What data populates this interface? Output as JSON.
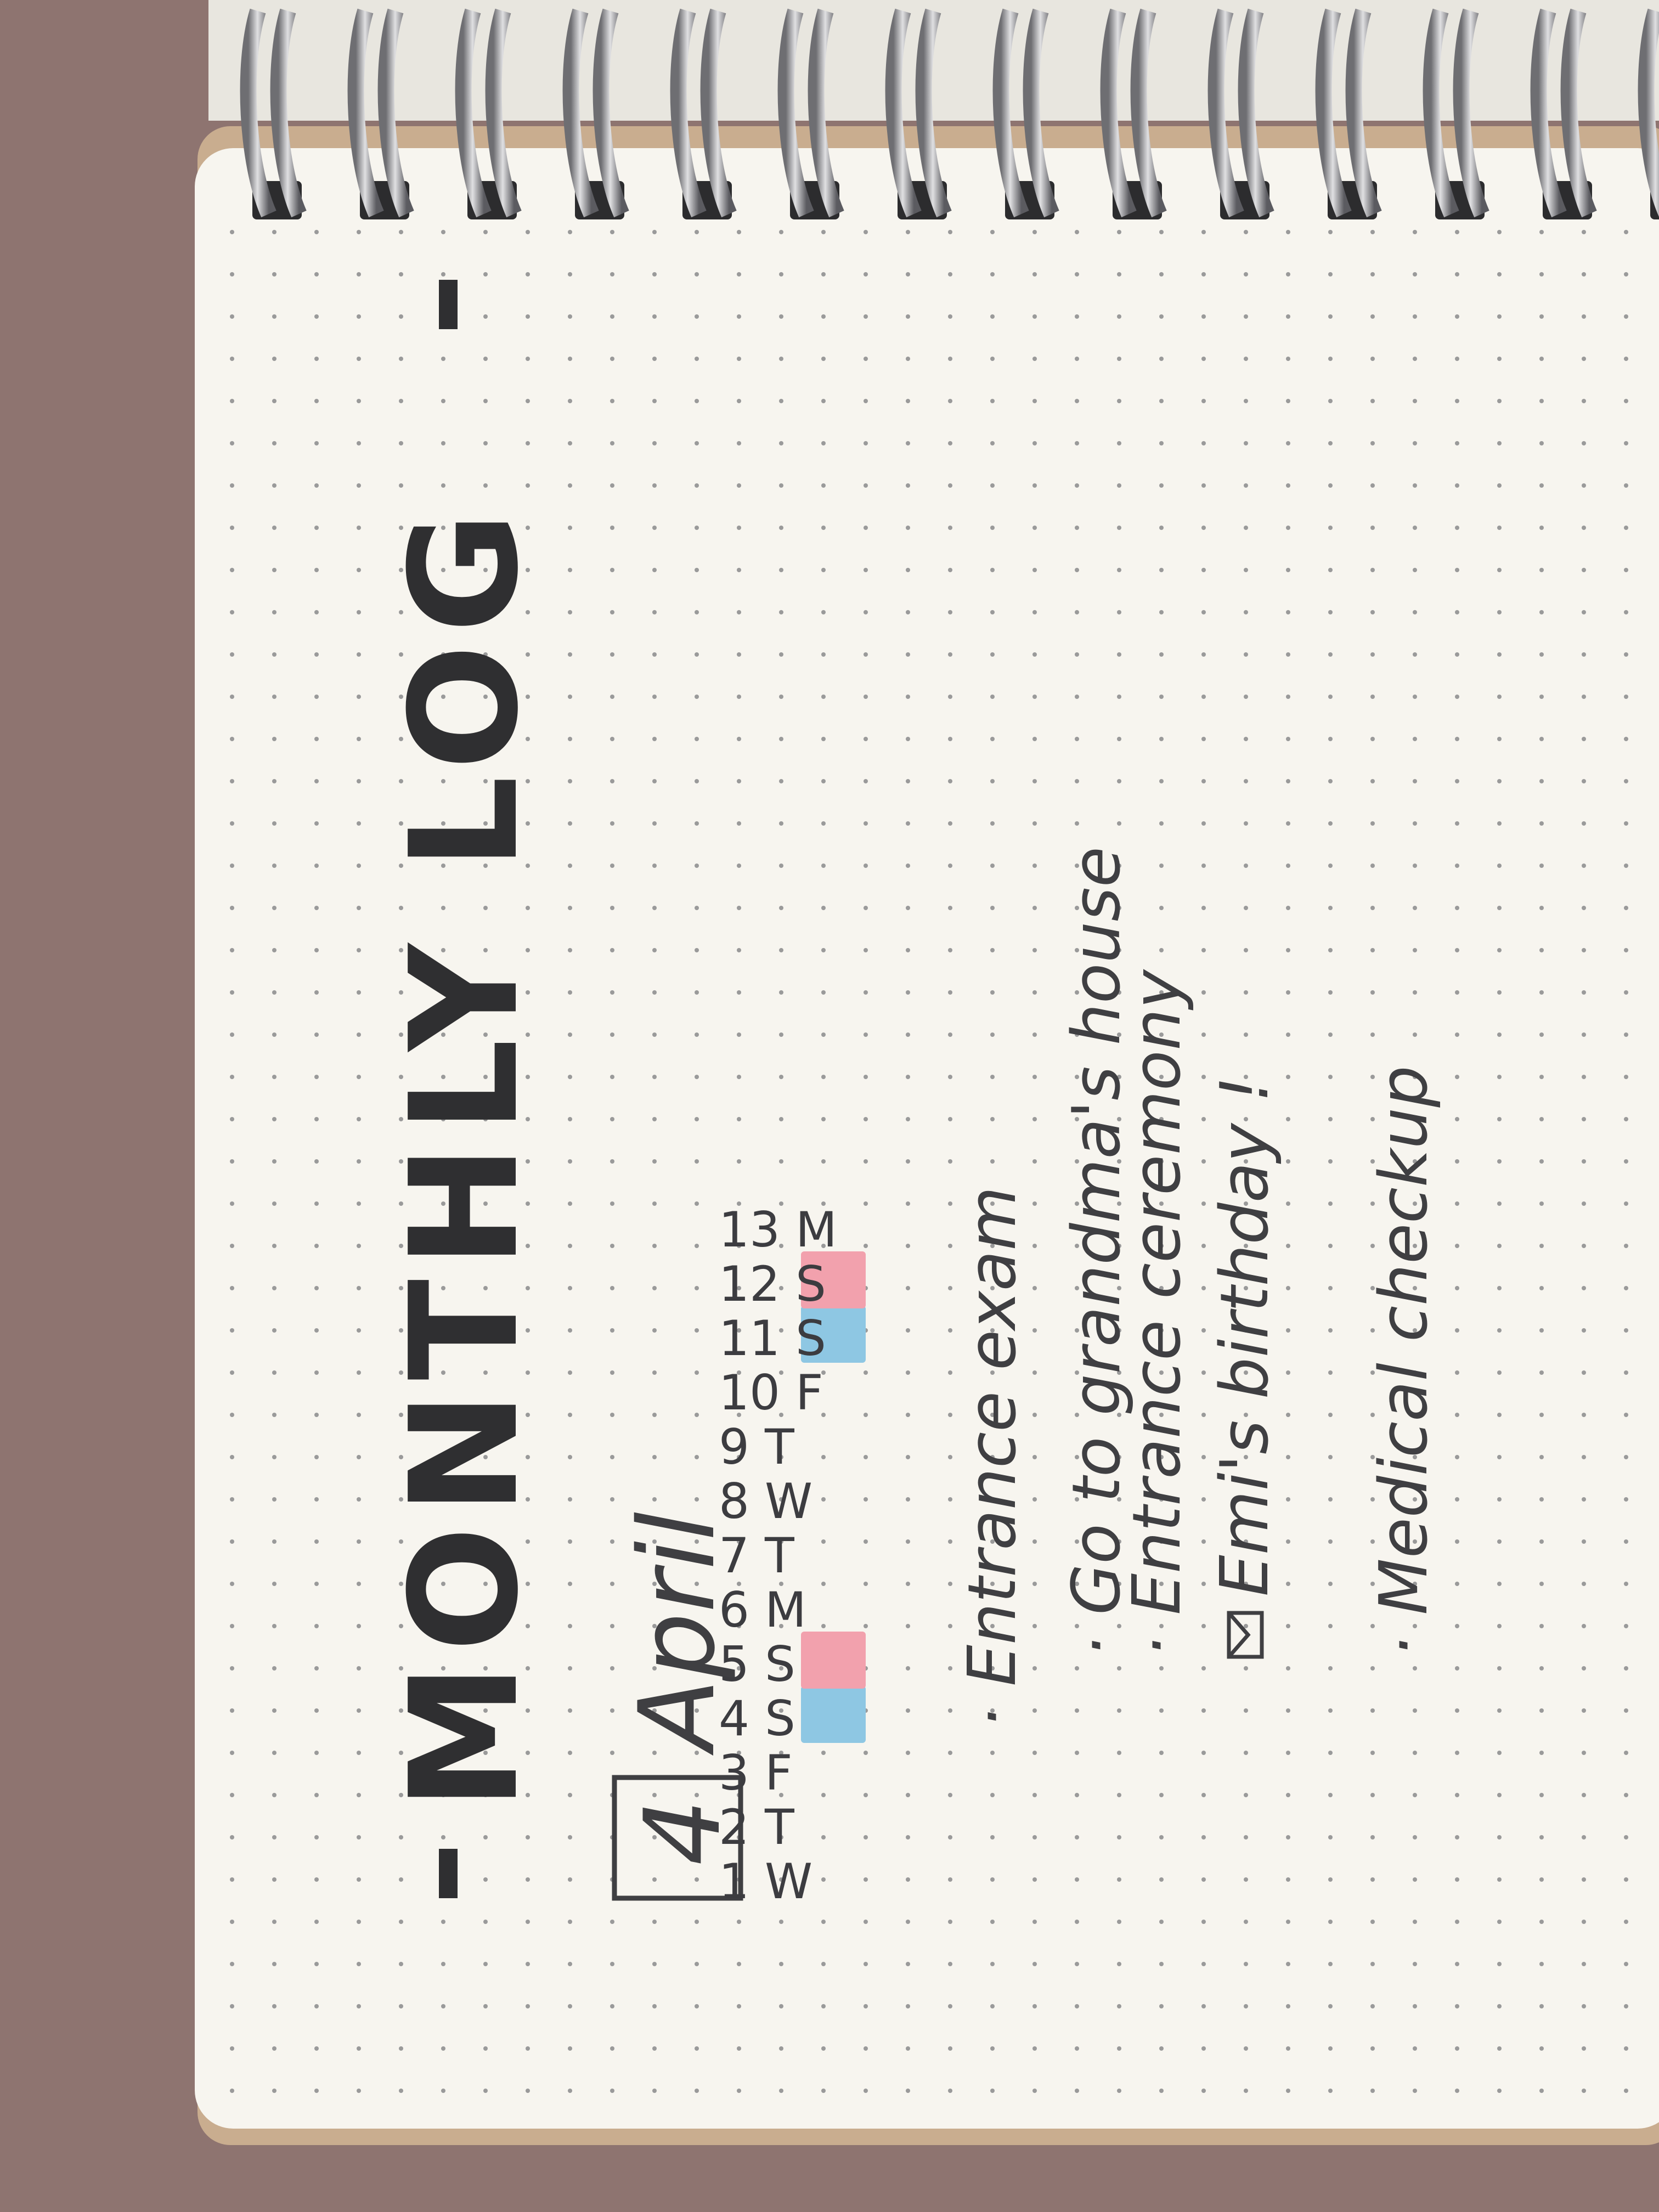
{
  "journal": {
    "title": "MONTHLY LOG",
    "month_number": "4",
    "month_name": "April",
    "days": [
      {
        "label": "1 W"
      },
      {
        "label": "2 T"
      },
      {
        "label": "3 F"
      },
      {
        "label": "4 S",
        "highlight": "#8ec7e3"
      },
      {
        "label": "5 S",
        "highlight": "#f2a1ad"
      },
      {
        "label": "6 M"
      },
      {
        "label": "7 T"
      },
      {
        "label": "8 W"
      },
      {
        "label": "9 T"
      },
      {
        "label": "10 F"
      },
      {
        "label": "11 S",
        "highlight": "#8ec7e3"
      },
      {
        "label": "12 S",
        "highlight": "#f2a1ad"
      },
      {
        "label": "13 M"
      }
    ],
    "events": [
      {
        "text": "· Entrance exam"
      },
      {
        "text": "· Go to grandma's house"
      },
      {
        "text": "· Entrance ceremony"
      },
      {
        "text": "Emi's birthday !",
        "icon": "envelope-icon"
      },
      {
        "text": "· Medical checkup"
      }
    ]
  },
  "colors": {
    "background": "#8e7470",
    "paper": "#f7f5ef",
    "ink": "#2f2f31",
    "saturday": "#8ec7e3",
    "sunday": "#f2a1ad",
    "spiral": "#8d8d92"
  }
}
